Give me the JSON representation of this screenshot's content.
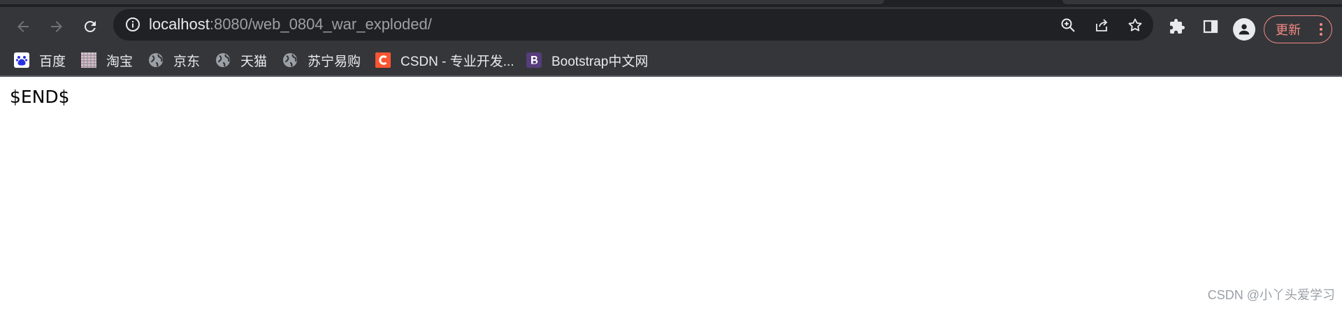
{
  "browser": {
    "address": {
      "host": "localhost",
      "rest": ":8080/web_0804_war_exploded/"
    },
    "update_label": "更新"
  },
  "bookmarks": [
    {
      "label": "百度",
      "icon": "baidu-icon"
    },
    {
      "label": "淘宝",
      "icon": "taobao-icon"
    },
    {
      "label": "京东",
      "icon": "globe-icon"
    },
    {
      "label": "天猫",
      "icon": "globe-icon"
    },
    {
      "label": "苏宁易购",
      "icon": "globe-icon"
    },
    {
      "label": "CSDN - 专业开发...",
      "icon": "csdn-icon"
    },
    {
      "label": "Bootstrap中文网",
      "icon": "bootstrap-icon"
    }
  ],
  "page": {
    "content": "$END$"
  },
  "watermark": "CSDN @小丫头爱学习",
  "colors": {
    "chrome_dark": "#35363a",
    "omnibox": "#202124",
    "update_accent": "#f28b82",
    "csdn": "#fc5531",
    "bootstrap": "#563d7c",
    "baidu": "#2932e1"
  }
}
